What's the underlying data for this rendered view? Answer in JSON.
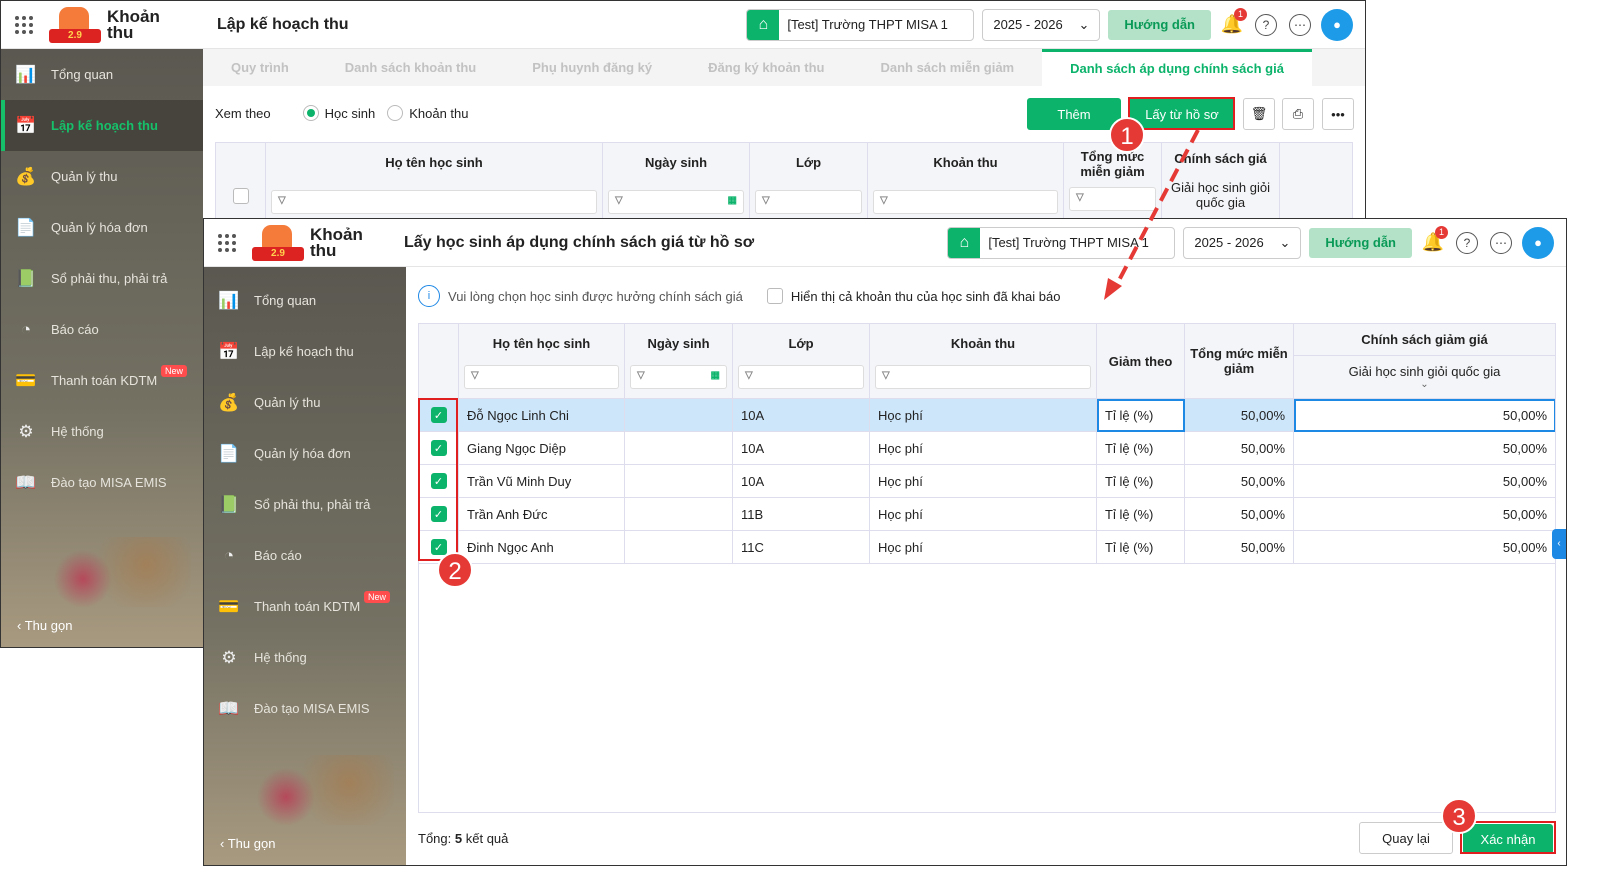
{
  "app": {
    "name_line1": "Khoản",
    "name_line2": "thu",
    "logo_text": "2.9",
    "school": "[Test] Trường THPT MISA 1",
    "year": "2025 - 2026",
    "guide": "Hướng dẫn",
    "notif_count": "1"
  },
  "back": {
    "title": "Lập kế hoạch thu",
    "tabs": [
      "Quy trình",
      "Danh sách khoản thu",
      "Phụ huynh đăng ký",
      "Đăng ký khoản thu",
      "Danh sách miễn giảm",
      "Danh sách áp dụng chính sách giá"
    ],
    "view_by": "Xem theo",
    "radio_student": "Học sinh",
    "radio_fee": "Khoản thu",
    "btn_add": "Thêm",
    "btn_from_profile": "Lấy từ hồ sơ",
    "columns": [
      "Họ tên học sinh",
      "Ngày sinh",
      "Lớp",
      "Khoản thu",
      "Tổng mức miễn giảm",
      "Chính sách giá"
    ],
    "policy_sub": "Giải học sinh giỏi quốc gia"
  },
  "sidebar": {
    "items": [
      {
        "label": "Tổng quan",
        "icon": "📊"
      },
      {
        "label": "Lập kế hoạch thu",
        "icon": "📅"
      },
      {
        "label": "Quản lý thu",
        "icon": "💰"
      },
      {
        "label": "Quản lý hóa đơn",
        "icon": "📄"
      },
      {
        "label": "Sổ phải thu, phải trả",
        "icon": "📗"
      },
      {
        "label": "Báo cáo",
        "icon": "◔"
      },
      {
        "label": "Thanh toán KDTM",
        "icon": "💳",
        "badge": "New"
      },
      {
        "label": "Hệ thống",
        "icon": "⚙"
      },
      {
        "label": "Đào tạo MISA EMIS",
        "icon": "📖"
      }
    ],
    "collapse": "Thu gọn"
  },
  "front": {
    "title": "Lấy học sinh áp dụng chính sách giá từ hồ sơ",
    "info": "Vui lòng chọn học sinh được hưởng chính sách giá",
    "show_declared": "Hiển thị cả khoản thu của học sinh đã khai báo",
    "columns": {
      "name": "Họ tên học sinh",
      "dob": "Ngày sinh",
      "class": "Lớp",
      "fee": "Khoản thu",
      "reduce_by": "Giảm theo",
      "total": "Tổng mức miễn giảm",
      "policy": "Chính sách giảm giá",
      "policy_sub": "Giải học sinh giỏi quốc gia"
    },
    "rows": [
      {
        "name": "Đỗ Ngọc Linh Chi",
        "dob": "",
        "class": "10A",
        "fee": "Học phí",
        "reduce_by": "Tỉ lệ (%)",
        "total": "50,00%",
        "policy": "50,00%"
      },
      {
        "name": "Giang Ngọc Diệp",
        "dob": "",
        "class": "10A",
        "fee": "Học phí",
        "reduce_by": "Tỉ lệ (%)",
        "total": "50,00%",
        "policy": "50,00%"
      },
      {
        "name": "Trần Vũ Minh Duy",
        "dob": "",
        "class": "10A",
        "fee": "Học phí",
        "reduce_by": "Tỉ lệ (%)",
        "total": "50,00%",
        "policy": "50,00%"
      },
      {
        "name": "Trần Anh Đức",
        "dob": "",
        "class": "11B",
        "fee": "Học phí",
        "reduce_by": "Tỉ lệ (%)",
        "total": "50,00%",
        "policy": "50,00%"
      },
      {
        "name": "Đinh Ngọc Anh",
        "dob": "",
        "class": "11C",
        "fee": "Học phí",
        "reduce_by": "Tỉ lệ (%)",
        "total": "50,00%",
        "policy": "50,00%"
      }
    ],
    "total_label": "Tổng:",
    "total_count": "5",
    "total_suffix": "kết quả",
    "btn_back": "Quay lại",
    "btn_confirm": "Xác nhận"
  },
  "steps": [
    "1",
    "2",
    "3"
  ]
}
